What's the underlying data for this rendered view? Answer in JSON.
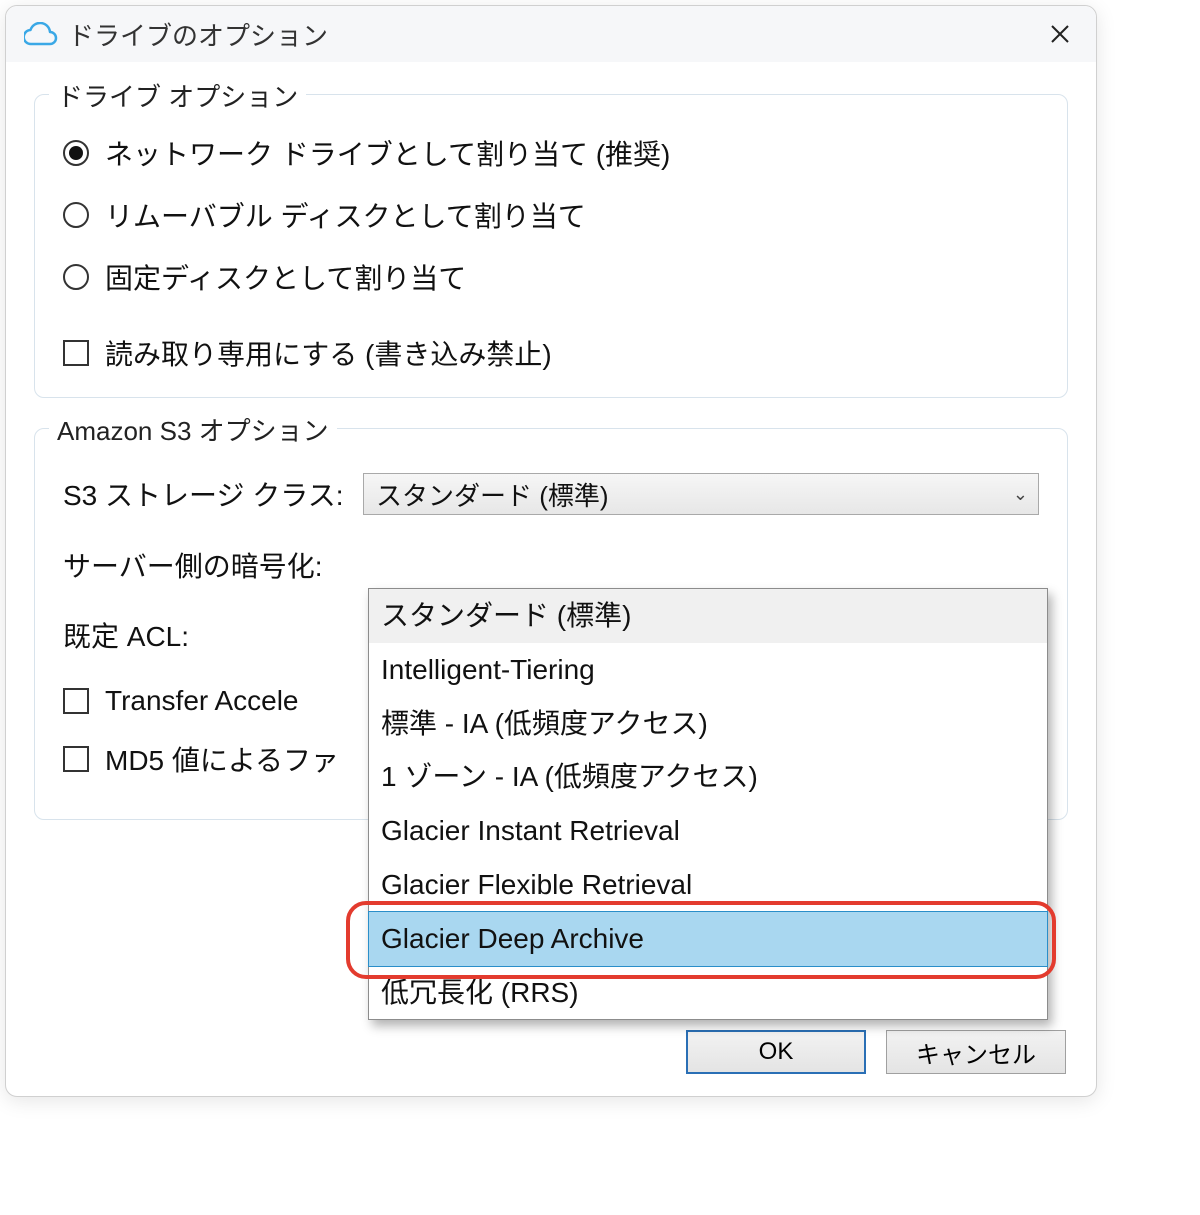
{
  "title": "ドライブのオプション",
  "drive_options": {
    "legend": "ドライブ オプション",
    "radios": [
      {
        "label": "ネットワーク ドライブとして割り当て (推奨)",
        "checked": true
      },
      {
        "label": "リムーバブル ディスクとして割り当て",
        "checked": false
      },
      {
        "label": "固定ディスクとして割り当て",
        "checked": false
      }
    ],
    "readonly_label": "読み取り専用にする (書き込み禁止)"
  },
  "s3_options": {
    "legend": "Amazon S3 オプション",
    "storage_class_label": "S3 ストレージ クラス:",
    "storage_class_value": "スタンダード (標準)",
    "encryption_label": "サーバー側の暗号化:",
    "acl_label": "既定 ACL:",
    "transfer_accel_label": "Transfer Accele",
    "md5_label": "MD5 値によるファ",
    "dropdown_items": [
      "スタンダード (標準)",
      "Intelligent-Tiering",
      "標準 - IA (低頻度アクセス)",
      "1 ゾーン - IA (低頻度アクセス)",
      "Glacier Instant Retrieval",
      "Glacier Flexible Retrieval",
      "Glacier Deep Archive",
      "低冗長化 (RRS)"
    ],
    "dropdown_hover_index": 0,
    "dropdown_selected_index": 6
  },
  "buttons": {
    "ok": "OK",
    "cancel": "キャンセル"
  }
}
